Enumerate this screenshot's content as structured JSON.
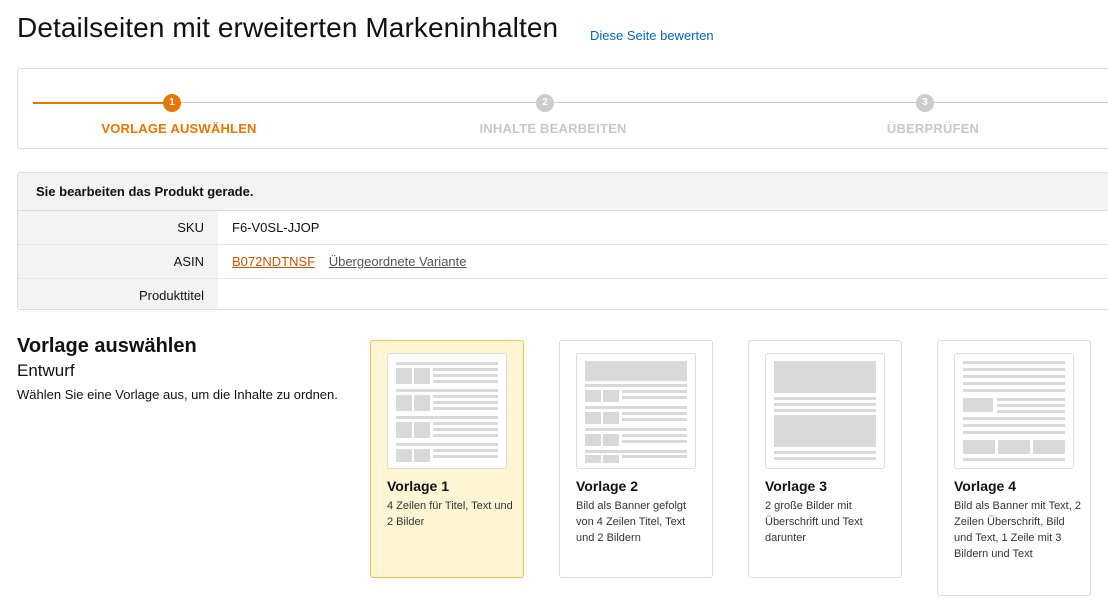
{
  "header": {
    "title": "Detailseiten mit erweiterten Markeninhalten",
    "rate_link": "Diese Seite bewerten"
  },
  "stepper": {
    "steps": [
      {
        "number": "1",
        "label": "VORLAGE AUSWÄHLEN",
        "active": true
      },
      {
        "number": "2",
        "label": "INHALTE BEARBEITEN",
        "active": false
      },
      {
        "number": "3",
        "label": "ÜBERPRÜFEN",
        "active": false
      }
    ]
  },
  "product": {
    "heading": "Sie bearbeiten das Produkt gerade.",
    "sku_label": "SKU",
    "sku_value": "F6-V0SL-JJOP",
    "asin_label": "ASIN",
    "asin_value": "B072NDTNSF",
    "variant_link": "Übergeordnete Variante",
    "title_label": "Produkttitel",
    "title_value": ""
  },
  "template_section": {
    "title": "Vorlage auswählen",
    "subtitle": "Entwurf",
    "description": "Wählen Sie eine Vorlage aus, um die Inhalte zu ordnen."
  },
  "templates": [
    {
      "title": "Vorlage 1",
      "description": "4 Zeilen für Titel, Text und 2 Bilder",
      "selected": true
    },
    {
      "title": "Vorlage 2",
      "description": "Bild als Banner gefolgt von 4 Zeilen Titel, Text und 2 Bildern",
      "selected": false
    },
    {
      "title": "Vorlage 3",
      "description": "2 große Bilder mit Überschrift und Text darunter",
      "selected": false
    },
    {
      "title": "Vorlage 4",
      "description": "Bild als Banner mit Text, 2 Zeilen Überschrift, Bild und Text, 1 Zeile mit 3 Bildern und Text",
      "selected": false
    }
  ],
  "colors": {
    "accent": "#e77600",
    "link": "#0066c0",
    "asin_link": "#c45500",
    "selected_card_bg": "#fdf5d4",
    "selected_card_border": "#f0c14b"
  }
}
